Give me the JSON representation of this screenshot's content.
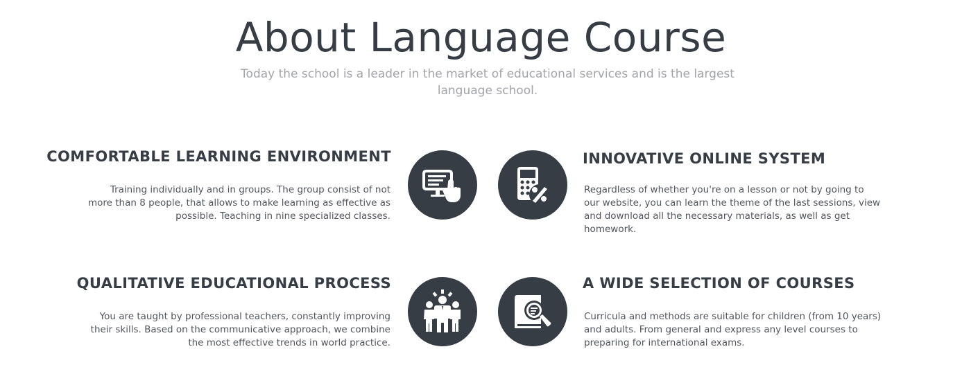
{
  "header": {
    "title": "About Language Course",
    "subtitle": "Today the school is a leader in the market of educational services and is the largest language school."
  },
  "features": [
    {
      "title": "COMFORTABLE LEARNING ENVIRONMENT",
      "text": "Training individually and in groups. The group consist of not more than 8 people, that allows to make learning as effective as possible. Teaching in nine specialized classes.",
      "icon": "monitor-touch-icon"
    },
    {
      "title": "INNOVATIVE ONLINE SYSTEM",
      "text": "Regardless of whether you're on a lesson or not by going to our website, you can learn the theme of the last sessions, view and download all the necessary materials, as well as get homework.",
      "icon": "calculator-percent-icon"
    },
    {
      "title": "QUALITATIVE EDUCATIONAL PROCESS",
      "text": "You are taught by professional teachers, constantly improving their skills. Based on the communicative approach, we combine the most effective trends in world practice.",
      "icon": "team-leader-icon"
    },
    {
      "title": "A WIDE SELECTION OF COURSES",
      "text": "Curricula and methods are suitable for children (from 10 years) and adults. From general and express any level courses to preparing for international exams.",
      "icon": "book-search-icon"
    }
  ],
  "colors": {
    "dark": "#363d45",
    "subtitle": "#a1a4a8",
    "body_text": "#50565d",
    "background": "#ffffff"
  }
}
